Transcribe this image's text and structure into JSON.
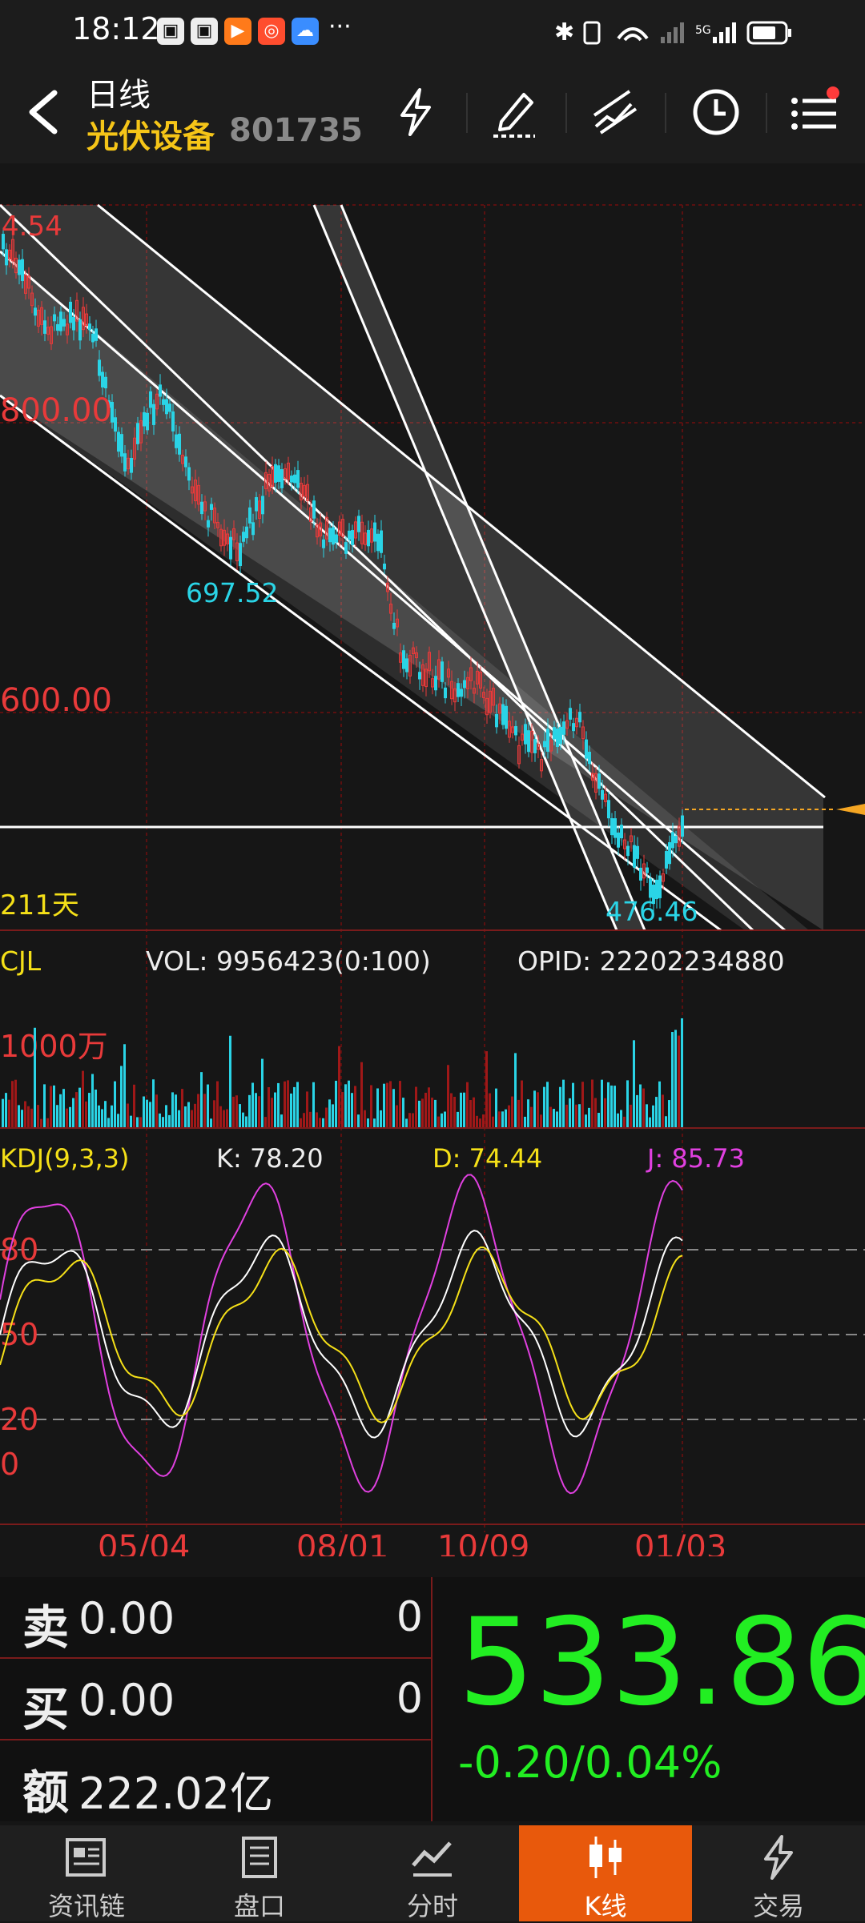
{
  "status_bar": {
    "time": "18:12",
    "more": "···"
  },
  "header": {
    "title": "日线",
    "stock_name": "光伏设备",
    "stock_code": "801735",
    "icons": [
      "back-icon",
      "lightning-icon",
      "pencil-icon",
      "trendline-icon",
      "clock-icon",
      "menu-icon"
    ]
  },
  "chart": {
    "price_labels": {
      "top": "4.54",
      "p800": "800.00",
      "p600": "600.00"
    },
    "annotations": {
      "local_low_1": "697.52",
      "local_low_2": "476.46",
      "days": "211天"
    },
    "volume": {
      "name": "CJL",
      "vol": "VOL: 9956423(0:100)",
      "opid": "OPID: 22202234880",
      "scale": "1000万"
    },
    "kdj": {
      "name": "KDJ(9,3,3)",
      "k": "K: 78.20",
      "d": "D: 74.44",
      "j": "J: 85.73",
      "levels": [
        "80",
        "50",
        "20",
        "0"
      ]
    },
    "dates": [
      "05/04",
      "08/01",
      "10/09",
      "01/03"
    ]
  },
  "quote": {
    "sell_label": "卖",
    "sell_price": "0.00",
    "sell_vol": "0",
    "buy_label": "买",
    "buy_price": "0.00",
    "buy_vol": "0",
    "amount_label": "额",
    "amount": "222.02亿",
    "price": "533.86",
    "change": "-0.20/0.04%"
  },
  "nav": {
    "items": [
      "资讯链",
      "盘口",
      "分时",
      "K线",
      "交易"
    ],
    "active": "K线"
  },
  "colors": {
    "up": "#e83a3a",
    "down": "#2ad4e6",
    "accent": "#e8590c",
    "price": "#22ee22",
    "yellow": "#f5c518"
  }
}
